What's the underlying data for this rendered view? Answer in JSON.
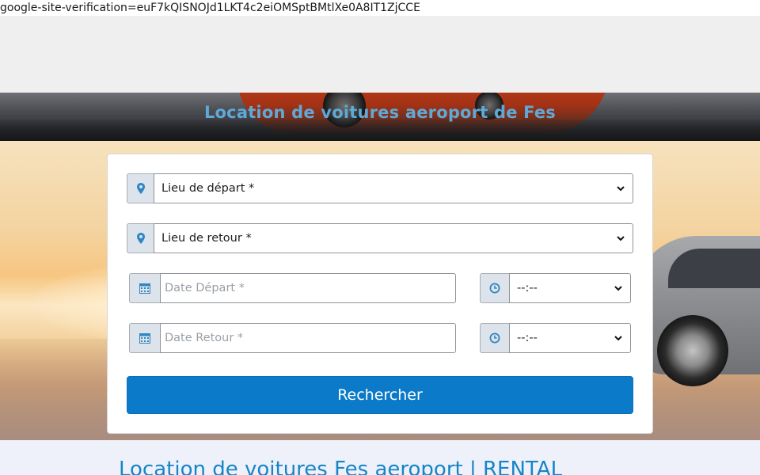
{
  "verification_text": "google-site-verification=euF7kQISNOJd1LKT4c2eiOMSptBMtlXe0A8IT1ZjCCE",
  "banner": {
    "title": "Location de voitures aeroport de Fes"
  },
  "form": {
    "pickup_location": {
      "value": "Lieu de départ *",
      "icon": "map-marker-icon"
    },
    "return_location": {
      "value": "Lieu de retour *",
      "icon": "map-marker-icon"
    },
    "pickup_date": {
      "placeholder": "Date Départ *",
      "icon": "calendar-icon"
    },
    "return_date": {
      "placeholder": "Date Retour *",
      "icon": "calendar-icon"
    },
    "pickup_time": {
      "value": "--:--",
      "icon": "clock-icon"
    },
    "return_time": {
      "value": "--:--",
      "icon": "clock-icon"
    },
    "search_label": "Rechercher"
  },
  "section": {
    "heading": "Location de voitures Fes aeroport | RENTAL"
  },
  "colors": {
    "accent": "#0b7ac8",
    "banner_title": "#5fa9d6",
    "heading": "#1685c8",
    "icon": "#2f86c3"
  }
}
